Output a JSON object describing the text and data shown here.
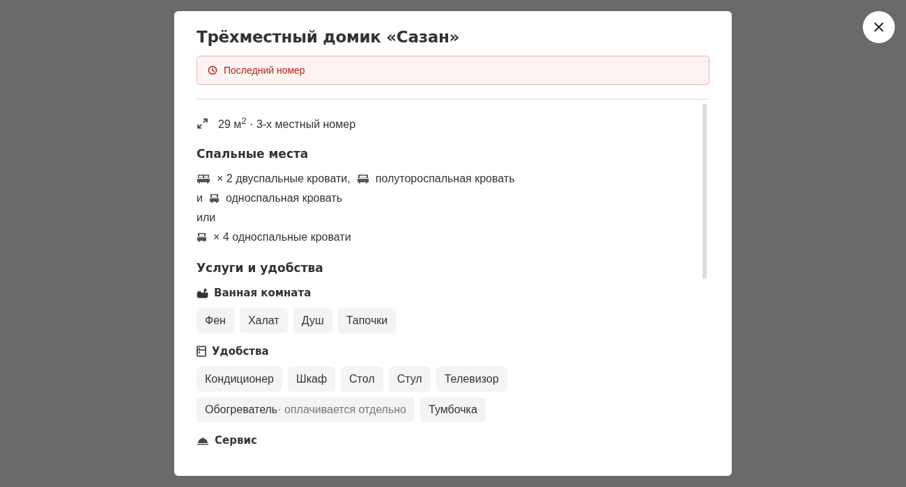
{
  "modal": {
    "title": "Трёхместный домик «Сазан»",
    "alert": {
      "text": "Последний номер"
    },
    "size": {
      "text": "29 м$^{2}$ · 3-х местный номер"
    },
    "sleeping": {
      "heading": "Спальные места",
      "lines": [
        [
          {
            "kind": "double"
          },
          {
            "kind": "text",
            "text": "× 2 двуспальные кровати,"
          },
          {
            "kind": "wide"
          },
          {
            "kind": "text",
            "text": "полутороспальная кровать"
          }
        ],
        [
          {
            "kind": "text",
            "text": "и"
          },
          {
            "kind": "single"
          },
          {
            "kind": "text",
            "text": "односпальная кровать"
          }
        ],
        [
          {
            "kind": "text",
            "text": "или"
          }
        ],
        [
          {
            "kind": "single"
          },
          {
            "kind": "text",
            "text": "× 4 односпальные кровати"
          }
        ]
      ]
    },
    "amenities": {
      "heading": "Услуги и удобства",
      "groups": [
        {
          "kind": "bath",
          "title": "Ванная комната",
          "chips": [
            {
              "label": "Фен"
            },
            {
              "label": "Халат"
            },
            {
              "label": "Душ"
            },
            {
              "label": "Тапочки"
            }
          ]
        },
        {
          "kind": "fridge",
          "title": "Удобства",
          "chips": [
            {
              "label": "Кондиционер"
            },
            {
              "label": "Шкаф"
            },
            {
              "label": "Стол"
            },
            {
              "label": "Стул"
            },
            {
              "label": "Телевизор"
            },
            {
              "label": "Обогреватель",
              "note": "· оплачивается отдельно"
            },
            {
              "label": "Тумбочка"
            }
          ]
        },
        {
          "kind": "bell",
          "title": "Сервис"
        }
      ]
    }
  }
}
